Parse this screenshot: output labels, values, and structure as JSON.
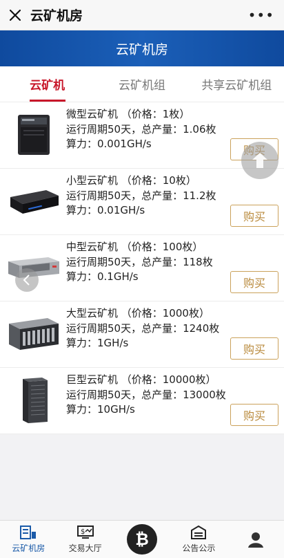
{
  "topbar": {
    "title": "云矿机房",
    "more": "•••"
  },
  "banner": {
    "title": "云矿机房"
  },
  "tabs": [
    {
      "label": "云矿机",
      "active": true
    },
    {
      "label": "云矿机组",
      "active": false
    },
    {
      "label": "共享云矿机组",
      "active": false
    }
  ],
  "items": [
    {
      "name": "微型云矿机 （价格：1枚）",
      "period": "运行周期50天，总产量：1.06枚",
      "power": "算力：0.001GH/s",
      "buy": "购买",
      "image": "tower-server-icon"
    },
    {
      "name": "小型云矿机 （价格：10枚）",
      "period": "运行周期50天，总产量：11.2枚",
      "power": "算力：0.01GH/s",
      "buy": "购买",
      "image": "box-server-icon"
    },
    {
      "name": "中型云矿机 （价格：100枚）",
      "period": "运行周期50天，总产量：118枚",
      "power": "算力：0.1GH/s",
      "buy": "购买",
      "image": "rack-server-icon"
    },
    {
      "name": "大型云矿机 （价格：1000枚）",
      "period": "运行周期50天，总产量：1240枚",
      "power": "算力：1GH/s",
      "buy": "购买",
      "image": "storage-array-icon"
    },
    {
      "name": "巨型云矿机 （价格：10000枚）",
      "period": "运行周期50天，总产量：13000枚",
      "power": "算力：10GH/s",
      "buy": "购买",
      "image": "cabinet-server-icon"
    }
  ],
  "bottomnav": [
    {
      "label": "云矿机房",
      "icon": "mining-room-icon",
      "active": true
    },
    {
      "label": "交易大厅",
      "icon": "trading-hall-icon",
      "active": false
    },
    {
      "label": "",
      "icon": "bitcoin-icon",
      "active": false
    },
    {
      "label": "公告公示",
      "icon": "announcement-icon",
      "active": false
    },
    {
      "label": "",
      "icon": "user-icon",
      "active": false
    }
  ],
  "colors": {
    "accent": "#c8172a",
    "banner": "#1b5fb8",
    "buy_border": "#caa15a",
    "nav_active": "#1a5aa8"
  }
}
